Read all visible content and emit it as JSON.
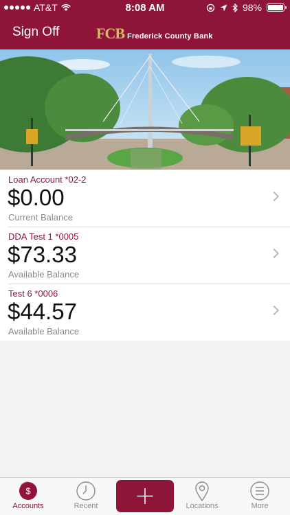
{
  "status_bar": {
    "carrier": "AT&T",
    "time": "8:08 AM",
    "battery": "98%",
    "battery_level": 0.98
  },
  "header": {
    "sign_off_label": "Sign Off",
    "logo_mark": "FCB",
    "logo_text": "Frederick County Bank"
  },
  "accounts": [
    {
      "name": "Loan Account *02-2",
      "amount": "$0.00",
      "label": "Current Balance"
    },
    {
      "name": "DDA Test 1 *0005",
      "amount": "$73.33",
      "label": "Available Balance"
    },
    {
      "name": "Test 6 *0006",
      "amount": "$44.57",
      "label": "Available Balance"
    }
  ],
  "tabs": {
    "accounts": "Accounts",
    "recent": "Recent",
    "locations": "Locations",
    "more": "More"
  },
  "colors": {
    "brand": "#8e1538",
    "gold": "#d6b86a"
  }
}
